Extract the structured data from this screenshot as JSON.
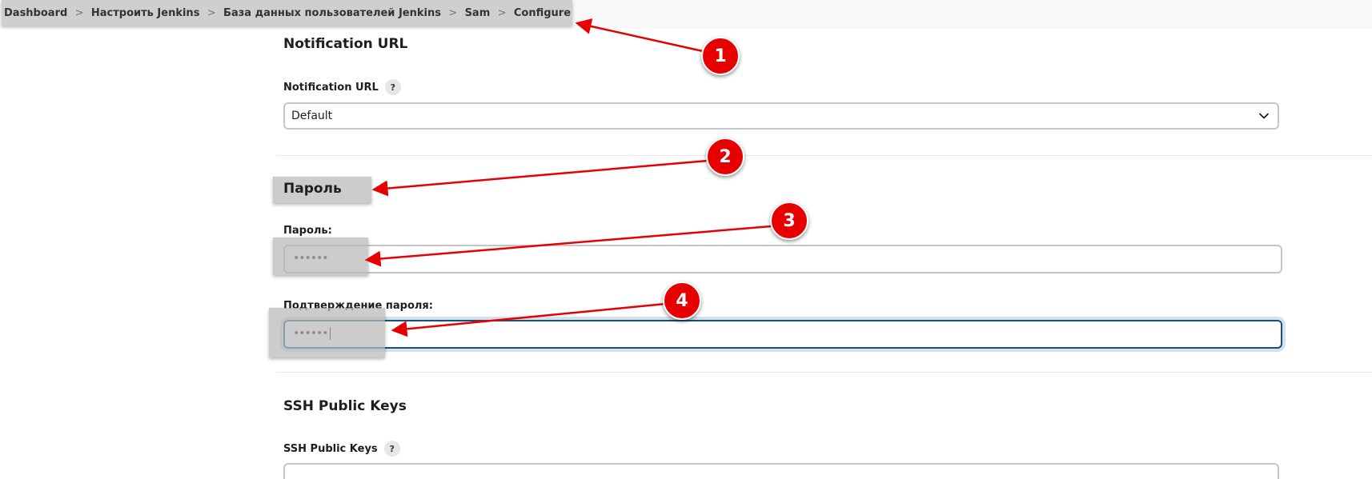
{
  "breadcrumb": {
    "items": [
      "Dashboard",
      "Настроить Jenkins",
      "База данных пользователей Jenkins",
      "Sam",
      "Configure"
    ],
    "separator": ">"
  },
  "notification": {
    "section_title": "Notification URL",
    "field_label": "Notification URL",
    "help": "?",
    "select_value": "Default"
  },
  "password": {
    "section_title": "Пароль",
    "password_label": "Пароль:",
    "password_value": "••••••",
    "confirm_label": "Подтверждение пароля:",
    "confirm_value": "••••••"
  },
  "ssh": {
    "section_title": "SSH Public Keys",
    "field_label": "SSH Public Keys",
    "help": "?"
  },
  "annotations": {
    "markers": [
      "1",
      "2",
      "3",
      "4"
    ],
    "color": "#e60000"
  },
  "colors": {
    "focus_border": "#1c4f74",
    "highlight": "#cfcfcf"
  }
}
